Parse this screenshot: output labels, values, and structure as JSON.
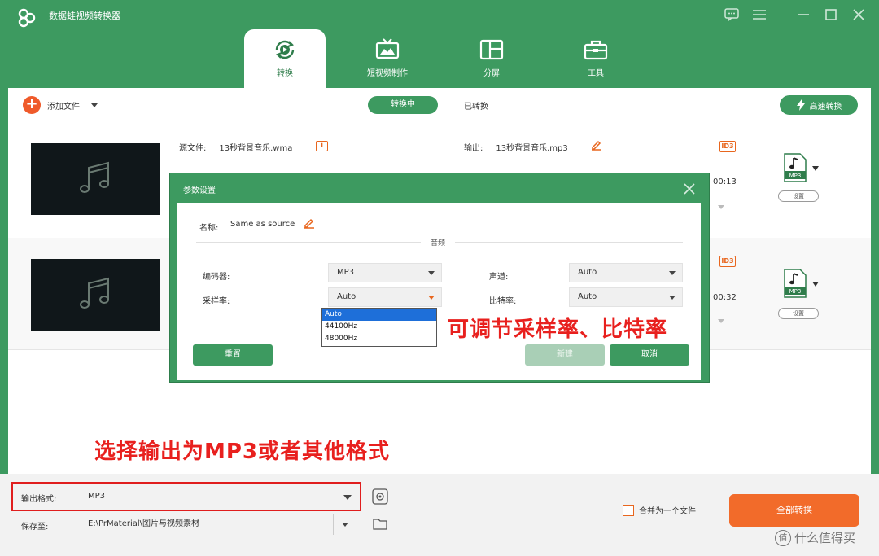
{
  "window": {
    "title": "数据蛙视频转换器"
  },
  "tabs": [
    {
      "label": "转换",
      "icon": "convert-icon",
      "active": true
    },
    {
      "label": "短视频制作",
      "icon": "tv-icon",
      "active": false
    },
    {
      "label": "分屏",
      "icon": "split-screen-icon",
      "active": false
    },
    {
      "label": "工具",
      "icon": "toolbox-icon",
      "active": false
    }
  ],
  "toolbar": {
    "add_file": "添加文件",
    "converting": "转换中",
    "converted": "已转换",
    "fast_convert": "高速转换"
  },
  "files": [
    {
      "source_label": "源文件:",
      "source_name": "13秒背景音乐.wma",
      "output_label": "输出:",
      "output_name": "13秒背景音乐.mp3",
      "duration": "00:13",
      "format_badge": "MP3",
      "settings": "设置"
    },
    {
      "duration": "00:32",
      "format_badge": "MP3",
      "settings": "设置"
    }
  ],
  "dialog": {
    "title": "参数设置",
    "name_label": "名称:",
    "name_value": "Same as source",
    "section": "音频",
    "encoder_label": "编码器:",
    "encoder_value": "MP3",
    "channel_label": "声道:",
    "channel_value": "Auto",
    "samplerate_label": "采样率:",
    "samplerate_value": "Auto",
    "bitrate_label": "比特率:",
    "bitrate_value": "Auto",
    "samplerate_options": [
      "Auto",
      "44100Hz",
      "48000Hz"
    ],
    "reset": "重置",
    "ok": "新建",
    "cancel": "取消"
  },
  "annotations": {
    "sample_rate_note": "可调节采样率、比特率",
    "format_note": "选择输出为MP3或者其他格式"
  },
  "bottom": {
    "output_format_label": "输出格式:",
    "output_format_value": "MP3",
    "save_to_label": "保存至:",
    "save_to_value": "E:\\PrMaterial\\图片与视频素材",
    "merge_label": "合并为一个文件",
    "convert_all": "全部转换"
  },
  "watermark": {
    "text": "什么值得买",
    "badge": "值"
  },
  "colors": {
    "brand_green": "#3d9a60",
    "accent_orange": "#f26b2a",
    "annotation_red": "#e8201e"
  }
}
